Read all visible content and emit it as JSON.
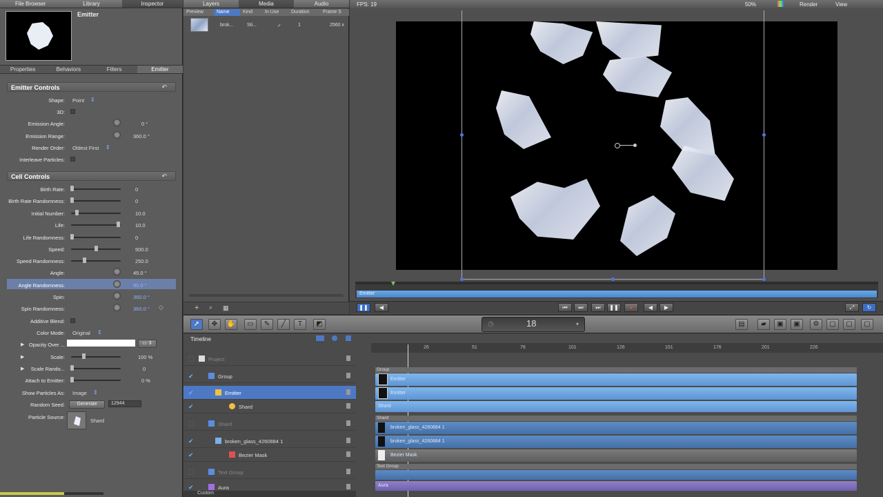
{
  "inspector": {
    "tabs": [
      "File Browser",
      "Library",
      "Inspector"
    ],
    "title": "Emitter",
    "subtabs": [
      "Properties",
      "Behaviors",
      "Filters",
      "Emitter"
    ],
    "emitter_controls": {
      "title": "Emitter Controls",
      "shape_label": "Shape:",
      "shape_value": "Point",
      "d3_label": "3D:",
      "emission_angle_label": "Emission Angle:",
      "emission_angle_value": "0 °",
      "emission_range_label": "Emission Range:",
      "emission_range_value": "360.0 °",
      "render_order_label": "Render Order:",
      "render_order_value": "Oldest First",
      "interleave_label": "Interleave Particles:"
    },
    "cell_controls": {
      "title": "Cell Controls",
      "rows": [
        {
          "label": "Birth Rate:",
          "value": "0"
        },
        {
          "label": "Birth Rate Randomness:",
          "value": "0"
        },
        {
          "label": "Initial Number:",
          "value": "10.0"
        },
        {
          "label": "Life:",
          "value": "10.0"
        },
        {
          "label": "Life Randomness:",
          "value": "0"
        },
        {
          "label": "Speed:",
          "value": "500.0"
        },
        {
          "label": "Speed Randomness:",
          "value": "250.0"
        },
        {
          "label": "Angle:",
          "value": "45.0 °"
        },
        {
          "label": "Angle Randomness:",
          "value": "90.0 °"
        },
        {
          "label": "Spin:",
          "value": "360.0 °"
        },
        {
          "label": "Spin Randomness:",
          "value": "360.0 °"
        }
      ],
      "additive_blend_label": "Additive Blend:",
      "color_mode_label": "Color Mode:",
      "color_mode_value": "Original",
      "opacity_label": "Opacity Over ...",
      "scale_label": "Scale:",
      "scale_value": "100 %",
      "scale_rand_label": "Scale Rando...",
      "scale_rand_value": "0",
      "attach_label": "Attach to Emitter:",
      "attach_value": "0 %",
      "show_as_label": "Show Particles As:",
      "show_as_value": "Image",
      "random_seed_label": "Random Seed:",
      "generate_label": "Generate",
      "seed_value": "12944",
      "source_label": "Particle Source:",
      "source_value": "Shard"
    }
  },
  "media": {
    "tabs": [
      "Layers",
      "Media",
      "Audio"
    ],
    "columns": [
      "Preview",
      "Name",
      "Kind",
      "In Use",
      "Duration",
      "Frame S"
    ],
    "row": {
      "name": "brok...",
      "kind": "Sti...",
      "in_use": "✓",
      "duration": "1",
      "frame": "2560 x"
    }
  },
  "canvas": {
    "fps": "FPS: 19",
    "zoom": "50%",
    "render": "Render",
    "view": "View",
    "mini_label": "Emitter"
  },
  "toolbar": {
    "frame_number": "18"
  },
  "timeline": {
    "title": "Timeline",
    "layers": [
      {
        "name": "Project",
        "checked": false
      },
      {
        "name": "Group",
        "checked": true
      },
      {
        "name": "Emitter",
        "checked": true
      },
      {
        "name": "Shard",
        "checked": true
      },
      {
        "name": "Shard",
        "checked": false
      },
      {
        "name": "broken_glass_4260884 1",
        "checked": true
      },
      {
        "name": "Bezier Mask",
        "checked": true
      },
      {
        "name": "Text Group",
        "checked": false
      },
      {
        "name": "Aura",
        "checked": true
      }
    ],
    "ruler_ticks": [
      "26",
      "51",
      "76",
      "101",
      "126",
      "151",
      "176",
      "201",
      "226"
    ],
    "tracks": {
      "group": "Group",
      "emitter1": "Emitter",
      "emitter2": "Emitter",
      "shard_cell": "Shard",
      "shard_group": "Shard",
      "glass1": "broken_glass_4260884 1",
      "glass2": "broken_glass_4260884 1",
      "mask": "Bezier Mask",
      "text_group": "Text Group",
      "aura": "Aura"
    },
    "bottom_label": "Custom"
  }
}
